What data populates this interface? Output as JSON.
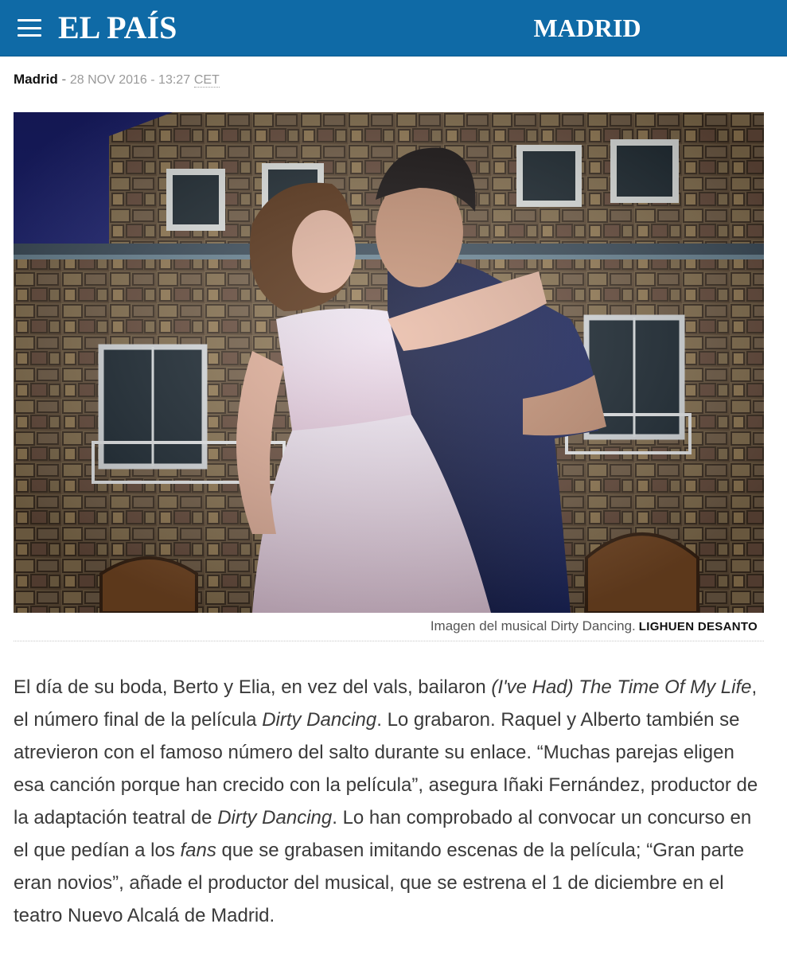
{
  "header": {
    "logo": "EL PAÍS",
    "section": "MADRID",
    "background": "#0f6aa6"
  },
  "byline": {
    "place": "Madrid",
    "separator": "-",
    "date": "28 NOV 2016 - 13:27",
    "timezone": "CET"
  },
  "photo": {
    "caption": "Imagen del musical Dirty Dancing.",
    "credit": "LIGHUEN DESANTO"
  },
  "article": {
    "paragraph": [
      {
        "text": "El día de su boda, Berto y Elia, en vez del vals, bailaron ",
        "italic": false
      },
      {
        "text": "(I've Had) The Time Of My Life",
        "italic": true
      },
      {
        "text": ", el número final de la película ",
        "italic": false
      },
      {
        "text": "Dirty Dancing",
        "italic": true
      },
      {
        "text": ". Lo grabaron. Raquel y Alberto también se atrevieron con el famoso número del salto durante su enlace. “Muchas parejas eligen esa canción porque han crecido con la película”, asegura Iñaki Fernández, productor de la adaptación teatral de ",
        "italic": false
      },
      {
        "text": "Dirty Dancing",
        "italic": true
      },
      {
        "text": ". Lo han comprobado al convocar un concurso en el que pedían a los ",
        "italic": false
      },
      {
        "text": "fans",
        "italic": true
      },
      {
        "text": " que se grabasen imitando escenas de la película; “Gran parte eran novios”, añade el productor del musical, que se estrena el 1 de diciembre en el teatro Nuevo Alcalá de Madrid.",
        "italic": false
      }
    ]
  }
}
